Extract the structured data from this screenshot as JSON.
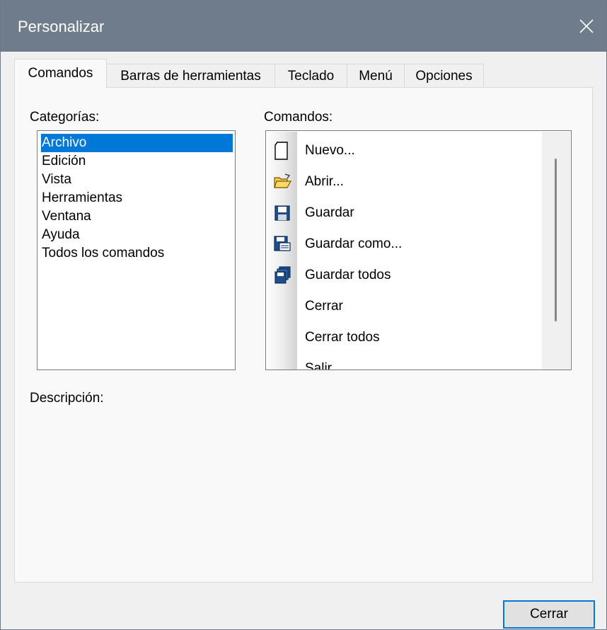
{
  "window": {
    "title": "Personalizar"
  },
  "tabs": [
    {
      "label": "Comandos",
      "active": true
    },
    {
      "label": "Barras de herramientas",
      "active": false
    },
    {
      "label": "Teclado",
      "active": false
    },
    {
      "label": "Menú",
      "active": false
    },
    {
      "label": "Opciones",
      "active": false
    }
  ],
  "categories": {
    "label": "Categorías:",
    "items": [
      "Archivo",
      "Edición",
      "Vista",
      "Herramientas",
      "Ventana",
      "Ayuda",
      "Todos los comandos"
    ],
    "selected": "Archivo"
  },
  "commands": {
    "label": "Comandos:",
    "items": [
      {
        "label": "Nuevo...",
        "icon": "new-document-icon"
      },
      {
        "label": "Abrir...",
        "icon": "open-folder-icon"
      },
      {
        "label": "Guardar",
        "icon": "save-icon"
      },
      {
        "label": "Guardar como...",
        "icon": "save-as-icon"
      },
      {
        "label": "Guardar todos",
        "icon": "save-all-icon"
      },
      {
        "label": "Cerrar",
        "icon": ""
      },
      {
        "label": "Cerrar todos",
        "icon": ""
      },
      {
        "label": "Salir",
        "icon": ""
      }
    ]
  },
  "description": {
    "label": "Descripción:"
  },
  "buttons": {
    "close": "Cerrar"
  },
  "colors": {
    "titlebar": "#6e7c8b",
    "selection": "#0078d7",
    "dialog_bg": "#f0f0f0"
  }
}
